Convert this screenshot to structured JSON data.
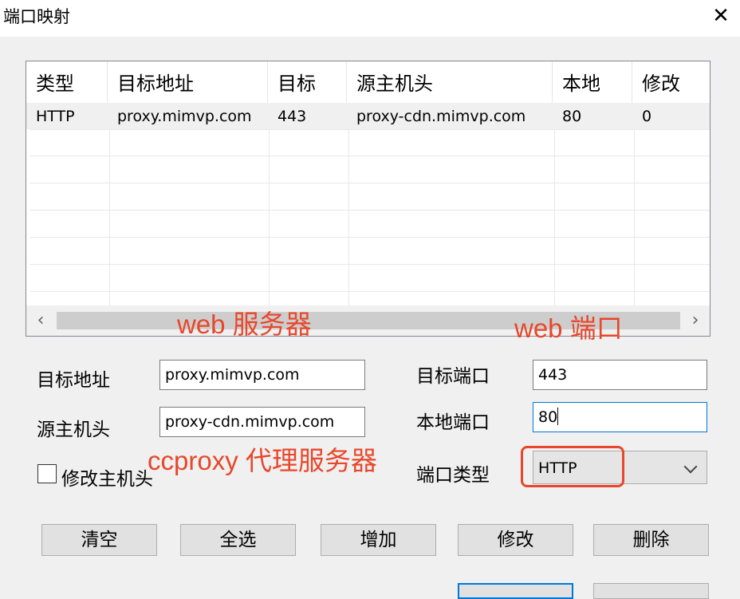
{
  "window": {
    "title": "端口映射",
    "close_glyph": "✕"
  },
  "list": {
    "columns": [
      "类型",
      "目标地址",
      "目标",
      "源主机头",
      "本地",
      "修改"
    ],
    "rows": [
      [
        "HTTP",
        "proxy.mimvp.com",
        "443",
        "proxy-cdn.mimvp.com",
        "80",
        "0"
      ]
    ],
    "scroll_left": "‹",
    "scroll_right": "›"
  },
  "annotations": {
    "web_server": "web 服务器",
    "web_port": "web 端口",
    "ccproxy": "ccproxy 代理服务器"
  },
  "form": {
    "target_address_label": "目标地址",
    "target_address_value": "proxy.mimvp.com",
    "source_host_label": "源主机头",
    "source_host_value": "proxy-cdn.mimvp.com",
    "modify_host_label": "修改主机头",
    "target_port_label": "目标端口",
    "target_port_value": "443",
    "local_port_label": "本地端口",
    "local_port_value": "80",
    "port_type_label": "端口类型",
    "port_type_value": "HTTP"
  },
  "buttons": {
    "clear": "清空",
    "select_all": "全选",
    "add": "增加",
    "modify": "修改",
    "delete": "删除"
  },
  "colors": {
    "annotation": "#e8472b",
    "focus": "#0078d7"
  }
}
